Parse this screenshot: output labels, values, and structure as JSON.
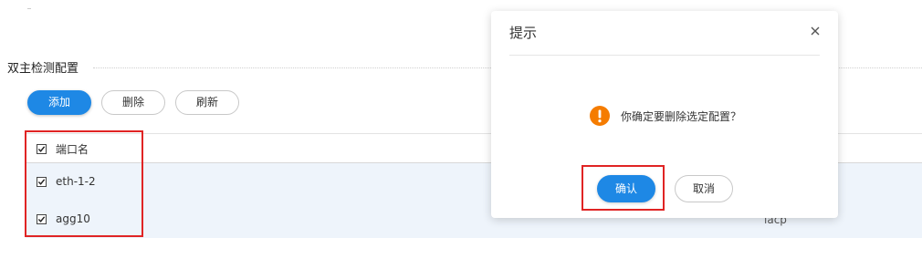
{
  "section": {
    "title": "双主检测配置"
  },
  "toolbar": {
    "add_label": "添加",
    "delete_label": "删除",
    "refresh_label": "刷新"
  },
  "table": {
    "header": {
      "port_name": "端口名",
      "checked": true
    },
    "rows": [
      {
        "port_name": "eth-1-2",
        "checked": true
      },
      {
        "port_name": "agg10",
        "checked": true,
        "extra": "lacp"
      }
    ]
  },
  "dialog": {
    "title": "提示",
    "message": "你确定要删除选定配置？",
    "confirm_label": "确认",
    "cancel_label": "取消",
    "icon": "warning-icon",
    "icon_color": "#f57c00"
  },
  "colors": {
    "primary": "#1e88e5",
    "highlight": "#e02424",
    "row_bg": "#eef4fb"
  }
}
